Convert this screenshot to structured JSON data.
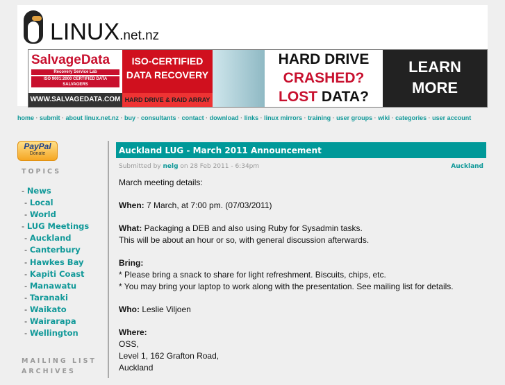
{
  "site": {
    "logo_main": "LINUX",
    "logo_suffix": ".net.nz"
  },
  "ad": {
    "brand": "SalvageData",
    "brand_sub": "Recovery Service Lab",
    "brand_cert": "ISO 9001:2000 CERTIFIED DATA SALVAGERS",
    "url": "WWW.SALVAGEDATA.COM",
    "headline1": "ISO-CERTIFIED",
    "headline2": "DATA RECOVERY",
    "tagline": "HARD DRIVE & RAID ARRAY",
    "q1": "HARD DRIVE",
    "q2": "CRASHED?",
    "q3a": "LOST",
    "q3b": "DATA?",
    "cta1": "LEARN",
    "cta2": "MORE"
  },
  "nav": [
    "home",
    "submit",
    "about linux.net.nz",
    "buy",
    "consultants",
    "contact",
    "download",
    "links",
    "linux mirrors",
    "training",
    "user groups",
    "wiki",
    "categories",
    "user account"
  ],
  "sidebar": {
    "paypal": "PayPal",
    "donate": "Donate",
    "topics_heading": "TOPICS",
    "mailing_heading": "MAILING LIST",
    "mailing_heading2": "ARCHIVES",
    "topics": [
      {
        "label": "News",
        "indent": 0
      },
      {
        "label": "Local",
        "indent": 1
      },
      {
        "label": "World",
        "indent": 1
      },
      {
        "label": "LUG Meetings",
        "indent": 0
      },
      {
        "label": "Auckland",
        "indent": 1
      },
      {
        "label": "Canterbury",
        "indent": 1
      },
      {
        "label": "Hawkes Bay",
        "indent": 1
      },
      {
        "label": "Kapiti Coast",
        "indent": 1
      },
      {
        "label": "Manawatu",
        "indent": 1
      },
      {
        "label": "Taranaki",
        "indent": 1
      },
      {
        "label": "Waikato",
        "indent": 1
      },
      {
        "label": "Wairarapa",
        "indent": 1
      },
      {
        "label": "Wellington",
        "indent": 1
      }
    ]
  },
  "article": {
    "title": "Auckland LUG - March 2011 Announcement",
    "submitted_by": "Submitted by",
    "author": "nelg",
    "date": "on 28 Feb 2011 - 6:34pm",
    "category": "Auckland",
    "intro": "March meeting details:",
    "when_label": "When:",
    "when": "7 March, at 7:00 pm. (07/03/2011)",
    "what_label": "What:",
    "what": "Packaging a DEB and also using Ruby for Sysadmin tasks.",
    "what2": "This will be about an hour or so, with general discussion afterwards.",
    "bring_label": "Bring:",
    "bring1": "* Please bring a snack to share for light refreshment. Biscuits, chips, etc.",
    "bring2": "* You may bring your laptop to work along with the presentation. See mailing list for details.",
    "who_label": "Who:",
    "who": "Leslie Viljoen",
    "where_label": "Where:",
    "where1": "OSS,",
    "where2": "Level 1, 162 Grafton Road,",
    "where3": "Auckland"
  }
}
